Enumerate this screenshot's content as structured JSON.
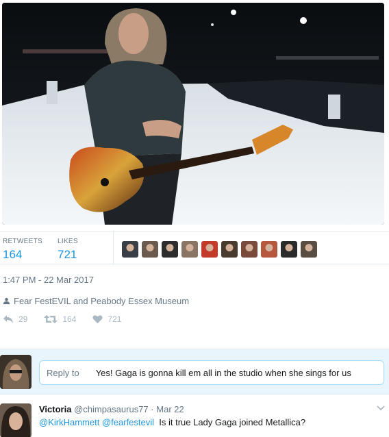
{
  "stats": {
    "retweets_label": "RETWEETS",
    "retweets_value": "164",
    "likes_label": "LIKES",
    "likes_value": "721"
  },
  "liker_avatars": [
    "#3a3f45",
    "#6b5a4d",
    "#2d2d2d",
    "#8a7565",
    "#c23b2a",
    "#4a3b2f",
    "#7a4b3c",
    "#b5583d",
    "#2b2b2b",
    "#5a4e42"
  ],
  "timestamp": "1:47 PM - 22 Mar 2017",
  "location": {
    "icon": "person-icon",
    "text": "Fear FestEVIL and Peabody Essex Museum"
  },
  "actions": {
    "reply_count": "29",
    "retweet_count": "164",
    "like_count": "721"
  },
  "reply_composer": {
    "prefix": "Reply to",
    "text": "Yes! Gaga is gonna kill em all in the studio when she sings for us"
  },
  "reply_tweet": {
    "name": "Victoria",
    "handle": "@chimpasaurus77",
    "separator": "·",
    "date": "Mar 22",
    "mention1": "@KirkHammett",
    "mention2": "@fearfestevil",
    "text": "Is it true Lady Gaga joined Metallica?"
  },
  "colors": {
    "accent": "#1b95e0",
    "muted": "#657786",
    "icon_gray": "#aab8c2",
    "reply_bar_bg": "#e8f5fd"
  }
}
